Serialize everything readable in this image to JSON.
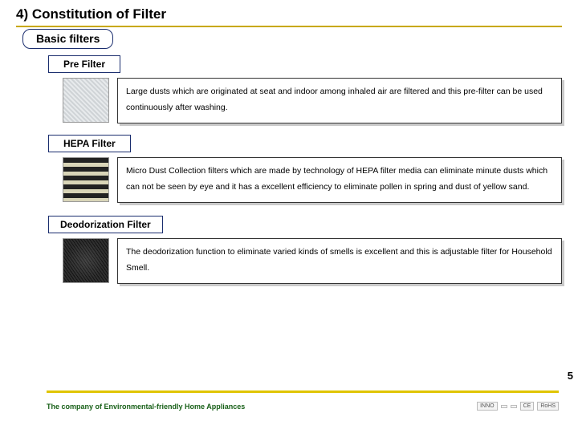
{
  "title": "4) Constitution of Filter",
  "subtitle": "Basic filters",
  "filters": [
    {
      "label": "Pre Filter",
      "description": "Large dusts which are originated at seat and indoor among inhaled air are filtered and this pre-filter can be used continuously after washing."
    },
    {
      "label": "HEPA Filter",
      "description": "Micro Dust Collection filters which are made by technology of HEPA filter media can eliminate minute dusts which can not be seen by eye and it has a excellent efficiency to eliminate pollen in spring and dust of yellow sand."
    },
    {
      "label": "Deodorization Filter",
      "description": "The deodorization function to eliminate varied kinds of smells is excellent and this is adjustable filter for Household Smell."
    }
  ],
  "footer": "The company of Environmental-friendly Home Appliances",
  "page_number": "5",
  "logos": [
    "INNO",
    "",
    "",
    "CE",
    "RoHS"
  ]
}
